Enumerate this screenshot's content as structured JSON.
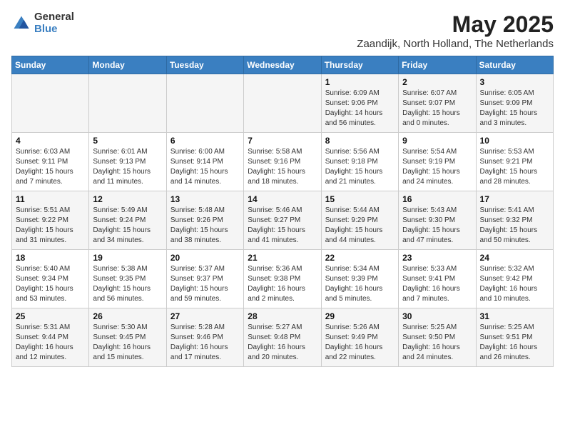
{
  "header": {
    "logo_general": "General",
    "logo_blue": "Blue",
    "month_title": "May 2025",
    "location": "Zaandijk, North Holland, The Netherlands"
  },
  "days_of_week": [
    "Sunday",
    "Monday",
    "Tuesday",
    "Wednesday",
    "Thursday",
    "Friday",
    "Saturday"
  ],
  "weeks": [
    [
      {
        "num": "",
        "info": ""
      },
      {
        "num": "",
        "info": ""
      },
      {
        "num": "",
        "info": ""
      },
      {
        "num": "",
        "info": ""
      },
      {
        "num": "1",
        "info": "Sunrise: 6:09 AM\nSunset: 9:06 PM\nDaylight: 14 hours\nand 56 minutes."
      },
      {
        "num": "2",
        "info": "Sunrise: 6:07 AM\nSunset: 9:07 PM\nDaylight: 15 hours\nand 0 minutes."
      },
      {
        "num": "3",
        "info": "Sunrise: 6:05 AM\nSunset: 9:09 PM\nDaylight: 15 hours\nand 3 minutes."
      }
    ],
    [
      {
        "num": "4",
        "info": "Sunrise: 6:03 AM\nSunset: 9:11 PM\nDaylight: 15 hours\nand 7 minutes."
      },
      {
        "num": "5",
        "info": "Sunrise: 6:01 AM\nSunset: 9:13 PM\nDaylight: 15 hours\nand 11 minutes."
      },
      {
        "num": "6",
        "info": "Sunrise: 6:00 AM\nSunset: 9:14 PM\nDaylight: 15 hours\nand 14 minutes."
      },
      {
        "num": "7",
        "info": "Sunrise: 5:58 AM\nSunset: 9:16 PM\nDaylight: 15 hours\nand 18 minutes."
      },
      {
        "num": "8",
        "info": "Sunrise: 5:56 AM\nSunset: 9:18 PM\nDaylight: 15 hours\nand 21 minutes."
      },
      {
        "num": "9",
        "info": "Sunrise: 5:54 AM\nSunset: 9:19 PM\nDaylight: 15 hours\nand 24 minutes."
      },
      {
        "num": "10",
        "info": "Sunrise: 5:53 AM\nSunset: 9:21 PM\nDaylight: 15 hours\nand 28 minutes."
      }
    ],
    [
      {
        "num": "11",
        "info": "Sunrise: 5:51 AM\nSunset: 9:22 PM\nDaylight: 15 hours\nand 31 minutes."
      },
      {
        "num": "12",
        "info": "Sunrise: 5:49 AM\nSunset: 9:24 PM\nDaylight: 15 hours\nand 34 minutes."
      },
      {
        "num": "13",
        "info": "Sunrise: 5:48 AM\nSunset: 9:26 PM\nDaylight: 15 hours\nand 38 minutes."
      },
      {
        "num": "14",
        "info": "Sunrise: 5:46 AM\nSunset: 9:27 PM\nDaylight: 15 hours\nand 41 minutes."
      },
      {
        "num": "15",
        "info": "Sunrise: 5:44 AM\nSunset: 9:29 PM\nDaylight: 15 hours\nand 44 minutes."
      },
      {
        "num": "16",
        "info": "Sunrise: 5:43 AM\nSunset: 9:30 PM\nDaylight: 15 hours\nand 47 minutes."
      },
      {
        "num": "17",
        "info": "Sunrise: 5:41 AM\nSunset: 9:32 PM\nDaylight: 15 hours\nand 50 minutes."
      }
    ],
    [
      {
        "num": "18",
        "info": "Sunrise: 5:40 AM\nSunset: 9:34 PM\nDaylight: 15 hours\nand 53 minutes."
      },
      {
        "num": "19",
        "info": "Sunrise: 5:38 AM\nSunset: 9:35 PM\nDaylight: 15 hours\nand 56 minutes."
      },
      {
        "num": "20",
        "info": "Sunrise: 5:37 AM\nSunset: 9:37 PM\nDaylight: 15 hours\nand 59 minutes."
      },
      {
        "num": "21",
        "info": "Sunrise: 5:36 AM\nSunset: 9:38 PM\nDaylight: 16 hours\nand 2 minutes."
      },
      {
        "num": "22",
        "info": "Sunrise: 5:34 AM\nSunset: 9:39 PM\nDaylight: 16 hours\nand 5 minutes."
      },
      {
        "num": "23",
        "info": "Sunrise: 5:33 AM\nSunset: 9:41 PM\nDaylight: 16 hours\nand 7 minutes."
      },
      {
        "num": "24",
        "info": "Sunrise: 5:32 AM\nSunset: 9:42 PM\nDaylight: 16 hours\nand 10 minutes."
      }
    ],
    [
      {
        "num": "25",
        "info": "Sunrise: 5:31 AM\nSunset: 9:44 PM\nDaylight: 16 hours\nand 12 minutes."
      },
      {
        "num": "26",
        "info": "Sunrise: 5:30 AM\nSunset: 9:45 PM\nDaylight: 16 hours\nand 15 minutes."
      },
      {
        "num": "27",
        "info": "Sunrise: 5:28 AM\nSunset: 9:46 PM\nDaylight: 16 hours\nand 17 minutes."
      },
      {
        "num": "28",
        "info": "Sunrise: 5:27 AM\nSunset: 9:48 PM\nDaylight: 16 hours\nand 20 minutes."
      },
      {
        "num": "29",
        "info": "Sunrise: 5:26 AM\nSunset: 9:49 PM\nDaylight: 16 hours\nand 22 minutes."
      },
      {
        "num": "30",
        "info": "Sunrise: 5:25 AM\nSunset: 9:50 PM\nDaylight: 16 hours\nand 24 minutes."
      },
      {
        "num": "31",
        "info": "Sunrise: 5:25 AM\nSunset: 9:51 PM\nDaylight: 16 hours\nand 26 minutes."
      }
    ]
  ]
}
